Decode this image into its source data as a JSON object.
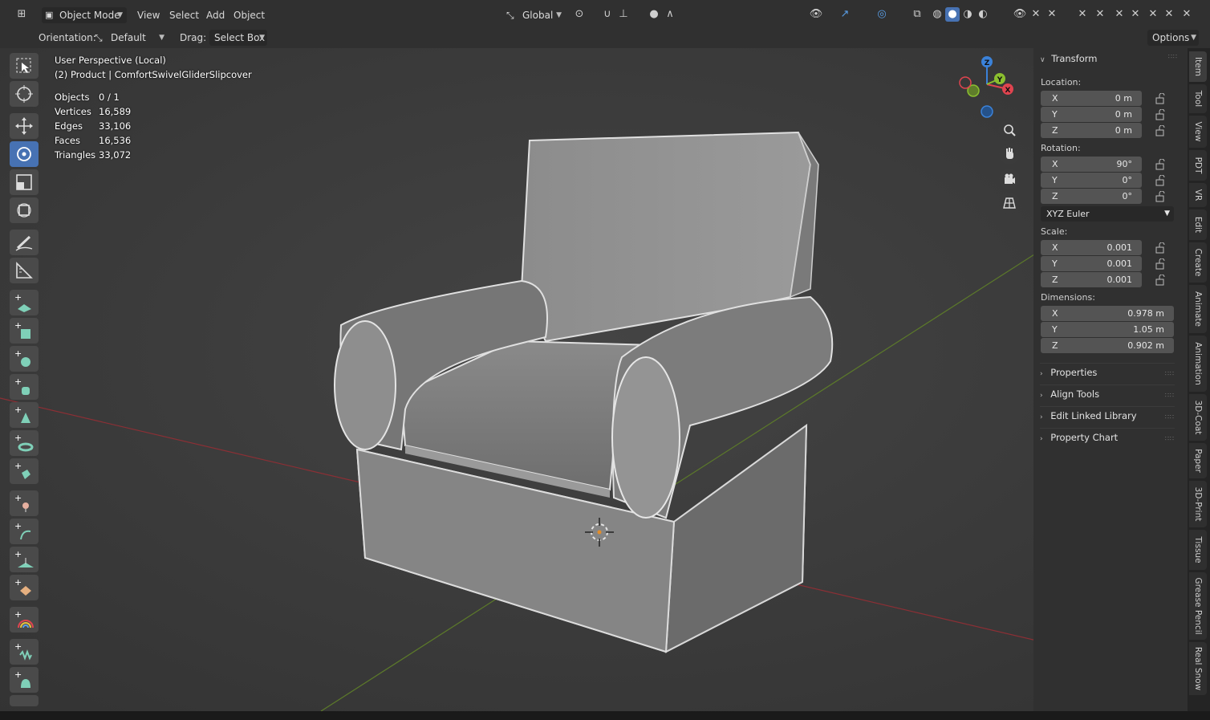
{
  "header": {
    "mode": "Object Mode",
    "menus": [
      "View",
      "Select",
      "Add",
      "Object"
    ],
    "transform_orientation": "Global"
  },
  "tool_settings": {
    "orientation_label": "Orientation:",
    "orientation_value": "Default",
    "drag_label": "Drag:",
    "drag_value": "Select Box",
    "options_label": "Options"
  },
  "viewport": {
    "view_name": "User Perspective (Local)",
    "object_name": "(2) Product | ComfortSwivelGliderSlipcover",
    "stats": [
      {
        "label": "Objects",
        "value": "0 / 1"
      },
      {
        "label": "Vertices",
        "value": "16,589"
      },
      {
        "label": "Edges",
        "value": "33,106"
      },
      {
        "label": "Faces",
        "value": "16,536"
      },
      {
        "label": "Triangles",
        "value": "33,072"
      }
    ],
    "gizmo": {
      "x": "X",
      "y": "Y",
      "z": "Z"
    }
  },
  "sidebar": {
    "transform_title": "Transform",
    "location_label": "Location:",
    "location": [
      {
        "axis": "X",
        "value": "0 m"
      },
      {
        "axis": "Y",
        "value": "0 m"
      },
      {
        "axis": "Z",
        "value": "0 m"
      }
    ],
    "rotation_label": "Rotation:",
    "rotation": [
      {
        "axis": "X",
        "value": "90°"
      },
      {
        "axis": "Y",
        "value": "0°"
      },
      {
        "axis": "Z",
        "value": "0°"
      }
    ],
    "rotation_mode": "XYZ Euler",
    "scale_label": "Scale:",
    "scale": [
      {
        "axis": "X",
        "value": "0.001"
      },
      {
        "axis": "Y",
        "value": "0.001"
      },
      {
        "axis": "Z",
        "value": "0.001"
      }
    ],
    "dimensions_label": "Dimensions:",
    "dimensions": [
      {
        "axis": "X",
        "value": "0.978 m"
      },
      {
        "axis": "Y",
        "value": "1.05 m"
      },
      {
        "axis": "Z",
        "value": "0.902 m"
      }
    ],
    "collapsed_panels": [
      "Properties",
      "Align Tools",
      "Edit Linked Library",
      "Property Chart"
    ]
  },
  "tabs": [
    "Item",
    "Tool",
    "View",
    "PDT",
    "VR",
    "Edit",
    "Create",
    "Animate",
    "Animation",
    "3D-Coat",
    "Paper",
    "3D-Print",
    "Tissue",
    "Grease Pencil",
    "Real Snow"
  ],
  "colors": {
    "accent": "#4772b3",
    "x_axis": "#e0444f",
    "y_axis": "#8bbf2f",
    "z_axis": "#3b82d9"
  }
}
